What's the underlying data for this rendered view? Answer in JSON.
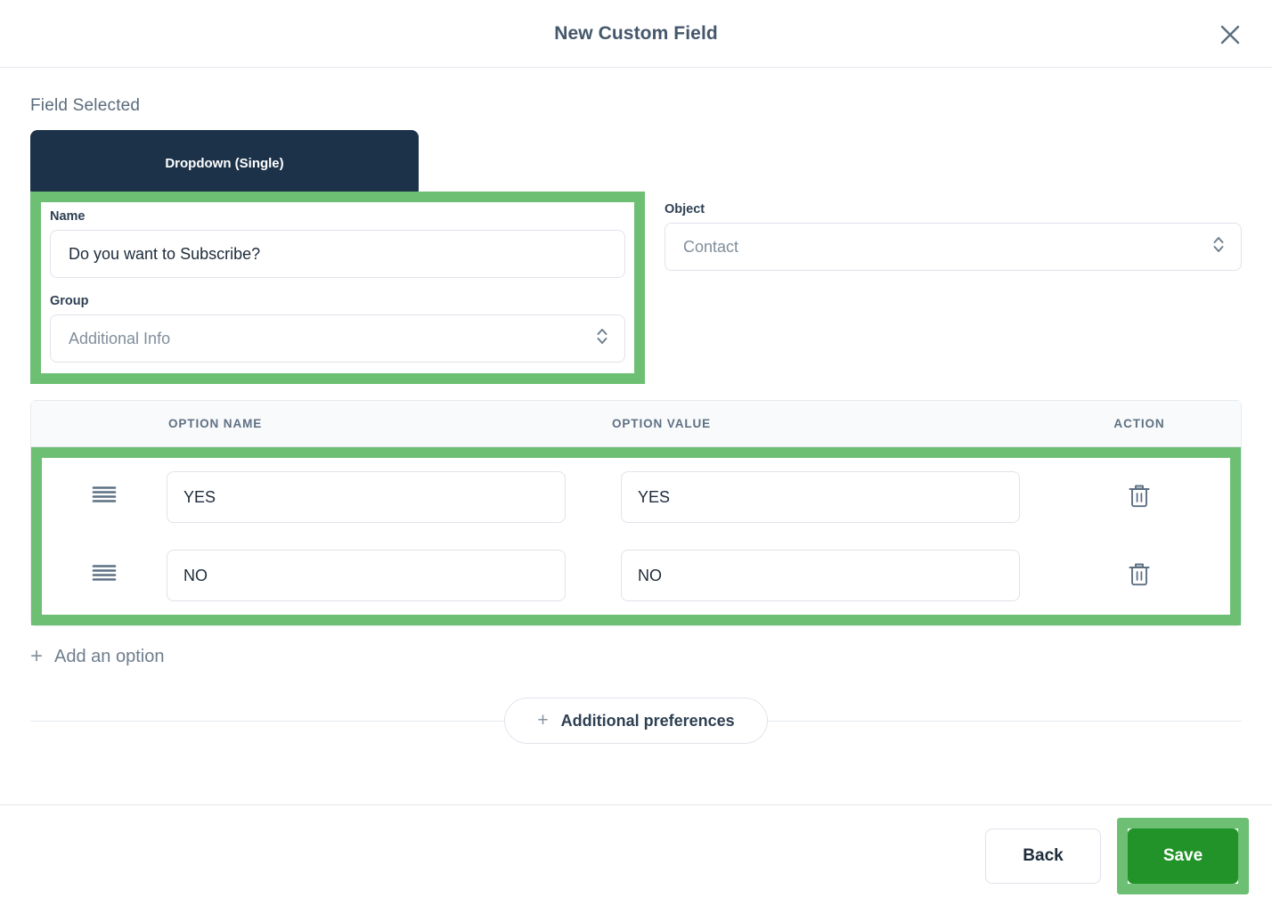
{
  "header": {
    "title": "New Custom Field",
    "close_icon": "close-icon"
  },
  "body": {
    "field_selected_label": "Field Selected",
    "field_type_chip": "Dropdown (Single)",
    "name": {
      "label": "Name",
      "value": "Do you want to Subscribe?"
    },
    "group": {
      "label": "Group",
      "value": "Additional Info"
    },
    "object": {
      "label": "Object",
      "value": "Contact"
    }
  },
  "options_table": {
    "headers": {
      "option_name": "OPTION NAME",
      "option_value": "OPTION VALUE",
      "action": "ACTION"
    },
    "rows": [
      {
        "name": "YES",
        "value": "YES",
        "handle_icon": "drag-handle-icon",
        "action_icon": "trash-icon"
      },
      {
        "name": "NO",
        "value": "NO",
        "handle_icon": "drag-handle-icon",
        "action_icon": "trash-icon"
      }
    ]
  },
  "actions": {
    "add_option": "Add an option",
    "add_option_icon": "plus-icon",
    "additional_preferences": "Additional preferences",
    "additional_preferences_icon": "plus-icon",
    "back": "Back",
    "save": "Save"
  },
  "colors": {
    "highlight_green": "#6cbf73",
    "save_green": "#219328",
    "chip_navy": "#1c3249",
    "title_slate": "#44576b",
    "label_slate": "#2d3f52",
    "muted_slate": "#808e9c",
    "table_header_bg": "#f9fafb",
    "border_gray": "#dfe3ea"
  }
}
